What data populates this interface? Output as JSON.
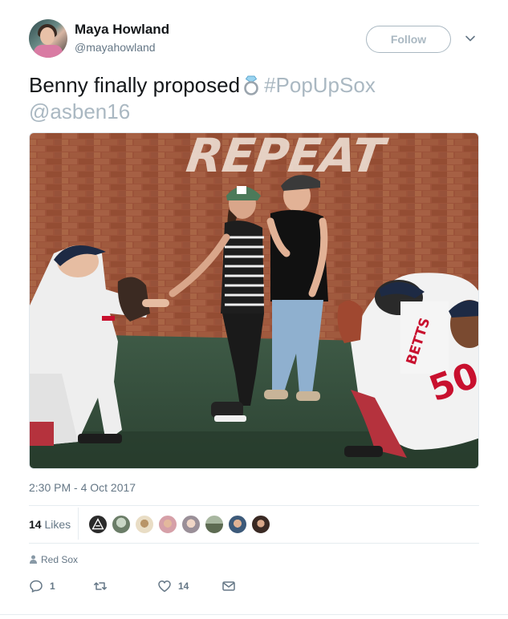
{
  "user": {
    "display_name": "Maya Howland",
    "handle": "@mayahowland"
  },
  "follow_button_label": "Follow",
  "tweet": {
    "text_start": "Benny finally proposed",
    "emoji": "ring-emoji",
    "hashtag": "#PopUpSox",
    "mention": "@asben16"
  },
  "photo": {
    "wall_sign": "REPEAT",
    "jersey_name": "BETTS",
    "jersey_number": "50"
  },
  "timestamp": "2:30 PM - 4 Oct 2017",
  "stats": {
    "likes_count": "14",
    "likes_label": "Likes",
    "liker_avatars": [
      "liker-1",
      "liker-2",
      "liker-3",
      "liker-4",
      "liker-5",
      "liker-6",
      "liker-7",
      "liker-8"
    ]
  },
  "context_label": "Red Sox",
  "actions": {
    "reply_count": "1",
    "retweet_count": "",
    "like_count": "14"
  },
  "colors": {
    "primary_text": "#14171a",
    "secondary_text": "#657786",
    "muted_link": "#aab8c2",
    "border": "#e6ecf0"
  }
}
